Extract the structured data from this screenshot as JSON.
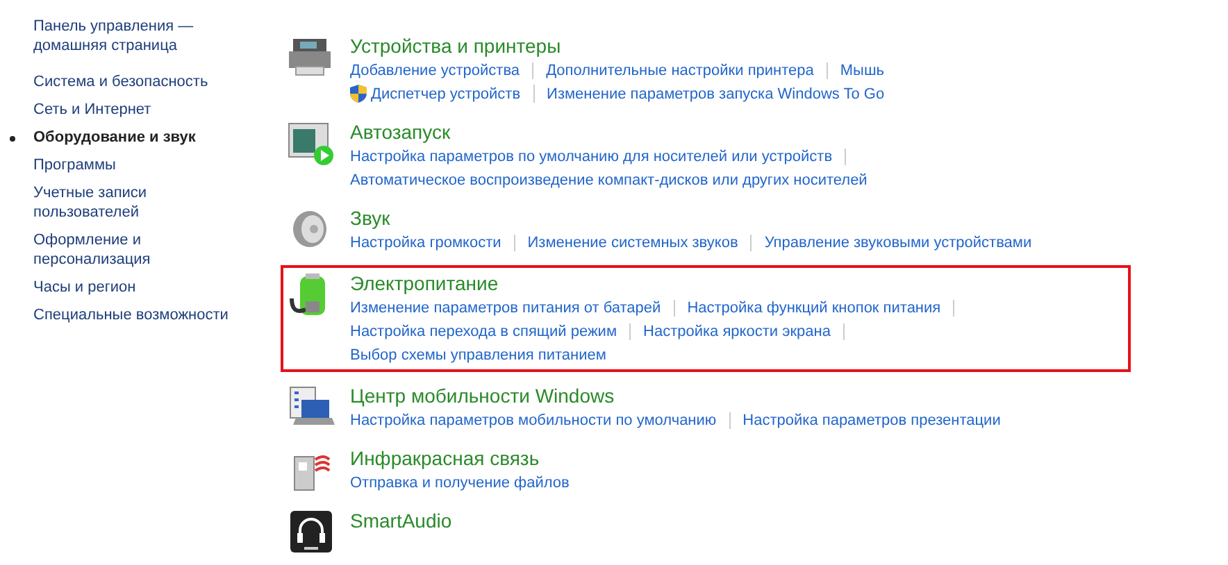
{
  "sidebar": {
    "items": [
      {
        "label": "Панель управления — домашняя страница",
        "selected": false
      },
      {
        "label": "Система и безопасность",
        "selected": false
      },
      {
        "label": "Сеть и Интернет",
        "selected": false
      },
      {
        "label": "Оборудование и звук",
        "selected": true
      },
      {
        "label": "Программы",
        "selected": false
      },
      {
        "label": "Учетные записи пользователей",
        "selected": false
      },
      {
        "label": "Оформление и персонализация",
        "selected": false
      },
      {
        "label": "Часы и регион",
        "selected": false
      },
      {
        "label": "Специальные возможности",
        "selected": false
      }
    ]
  },
  "sections": [
    {
      "title": "Устройства и принтеры",
      "highlighted": false,
      "lines": [
        {
          "trailing_divider": false,
          "links": [
            {
              "label": "Добавление устройства",
              "shield": false
            },
            {
              "label": "Дополнительные настройки принтера",
              "shield": false
            },
            {
              "label": "Мышь",
              "shield": false
            }
          ]
        },
        {
          "trailing_divider": false,
          "links": [
            {
              "label": "Диспетчер устройств",
              "shield": true
            },
            {
              "label": "Изменение параметров запуска Windows To Go",
              "shield": false
            }
          ]
        }
      ]
    },
    {
      "title": "Автозапуск",
      "highlighted": false,
      "lines": [
        {
          "trailing_divider": true,
          "links": [
            {
              "label": "Настройка параметров по умолчанию для носителей или устройств",
              "shield": false
            }
          ]
        },
        {
          "trailing_divider": false,
          "links": [
            {
              "label": "Автоматическое воспроизведение компакт-дисков или других носителей",
              "shield": false
            }
          ]
        }
      ]
    },
    {
      "title": "Звук",
      "highlighted": false,
      "lines": [
        {
          "trailing_divider": false,
          "links": [
            {
              "label": "Настройка громкости",
              "shield": false
            },
            {
              "label": "Изменение системных звуков",
              "shield": false
            },
            {
              "label": "Управление звуковыми устройствами",
              "shield": false
            }
          ]
        }
      ]
    },
    {
      "title": "Электропитание",
      "highlighted": true,
      "lines": [
        {
          "trailing_divider": true,
          "links": [
            {
              "label": "Изменение параметров питания от батарей",
              "shield": false
            },
            {
              "label": "Настройка функций кнопок питания",
              "shield": false
            }
          ]
        },
        {
          "trailing_divider": true,
          "links": [
            {
              "label": "Настройка перехода в спящий режим",
              "shield": false
            },
            {
              "label": "Настройка яркости экрана",
              "shield": false
            }
          ]
        },
        {
          "trailing_divider": false,
          "links": [
            {
              "label": "Выбор схемы управления питанием",
              "shield": false
            }
          ]
        }
      ]
    },
    {
      "title": "Центр мобильности Windows",
      "highlighted": false,
      "lines": [
        {
          "trailing_divider": false,
          "links": [
            {
              "label": "Настройка параметров мобильности по умолчанию",
              "shield": false
            },
            {
              "label": "Настройка параметров презентации",
              "shield": false
            }
          ]
        }
      ]
    },
    {
      "title": "Инфракрасная связь",
      "highlighted": false,
      "lines": [
        {
          "trailing_divider": false,
          "links": [
            {
              "label": "Отправка и получение файлов",
              "shield": false
            }
          ]
        }
      ]
    },
    {
      "title": "SmartAudio",
      "highlighted": false
    }
  ]
}
